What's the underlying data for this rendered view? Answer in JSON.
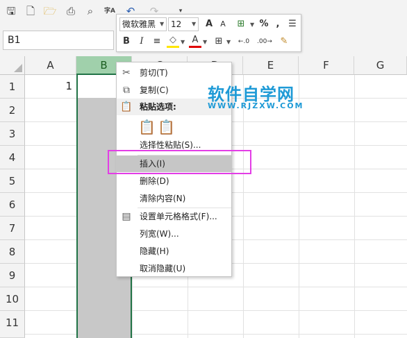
{
  "toolbar": {
    "font_name": "微软雅黑",
    "font_size": "12",
    "bold": "B",
    "italic": "I",
    "font_grow": "A",
    "font_shrink": "A",
    "font_color": "A",
    "percent": "%",
    "comma": ",",
    "inc_decimal": "←.0",
    "dec_decimal": ".00→",
    "phonetic_label": "字A"
  },
  "name_box": "B1",
  "columns": [
    "A",
    "B",
    "C",
    "D",
    "E",
    "F",
    "G"
  ],
  "rows": [
    "1",
    "2",
    "3",
    "4",
    "5",
    "6",
    "7",
    "8",
    "9",
    "10",
    "11"
  ],
  "cells": {
    "A1": "1"
  },
  "context_menu": {
    "cut": "剪切(T)",
    "copy": "复制(C)",
    "paste_options": "粘贴选项:",
    "paste_special": "选择性粘贴(S)...",
    "insert": "插入(I)",
    "delete": "删除(D)",
    "clear_contents": "清除内容(N)",
    "format_cells": "设置单元格格式(F)...",
    "column_width": "列宽(W)...",
    "hide": "隐藏(H)",
    "unhide": "取消隐藏(U)"
  },
  "watermark": {
    "title": "软件自学网",
    "url": "WWW.RJZXW.COM"
  },
  "colors": {
    "accent_green": "#217346",
    "selected_header": "#a0d0ab",
    "highlight_box": "#e33de6",
    "watermark_blue": "#1e9ad6"
  },
  "icons": [
    "save-icon",
    "new-file-icon",
    "open-folder-icon",
    "print-icon",
    "print-preview-icon",
    "phonetic-icon",
    "undo-icon",
    "redo-icon",
    "customize-icon",
    "cut-icon",
    "copy-icon",
    "paste-icon",
    "format-cells-icon"
  ]
}
